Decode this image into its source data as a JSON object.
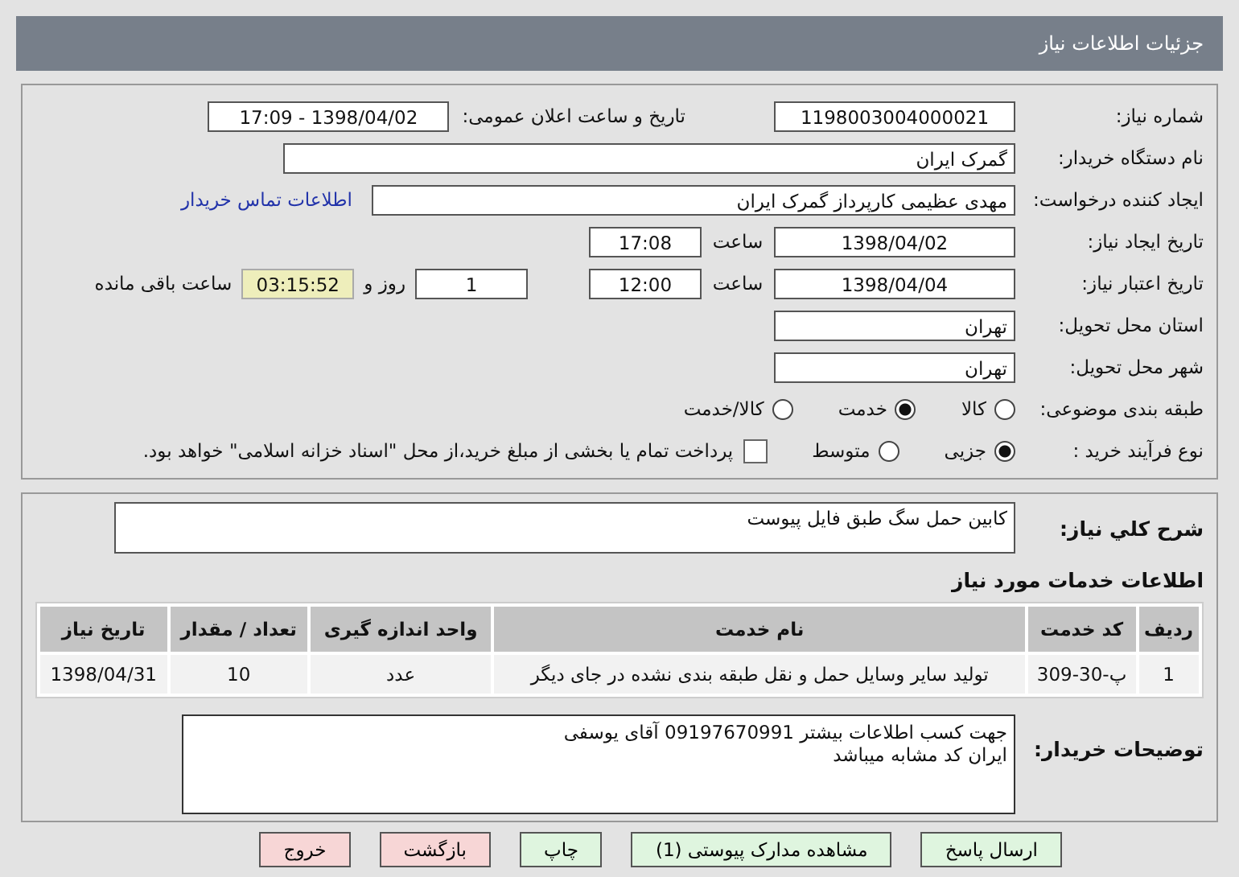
{
  "page_title": "جزئیات اطلاعات نیاز",
  "need_number": {
    "label": "شماره نیاز:",
    "value": "1198003004000021"
  },
  "announce": {
    "label": "تاریخ و ساعت اعلان عمومی:",
    "value": "1398/04/02 - 17:09"
  },
  "buyer": {
    "label": "نام دستگاه خریدار:",
    "value": "گمرک ایران"
  },
  "requester": {
    "label": "ایجاد کننده درخواست:",
    "value": "مهدی عظیمی کارپرداز گمرک ایران",
    "link": "اطلاعات تماس خریدار"
  },
  "created": {
    "label": "تاریخ ایجاد نیاز:",
    "date": "1398/04/02",
    "time_label": "ساعت",
    "time": "17:08"
  },
  "valid": {
    "label": "تاریخ اعتبار نیاز:",
    "date": "1398/04/04",
    "time_label": "ساعت",
    "time": "12:00",
    "days": "1",
    "days_label": "روز و",
    "remaining": "03:15:52",
    "remaining_label": "ساعت باقی مانده"
  },
  "province": {
    "label": "استان محل تحویل:",
    "value": "تهران"
  },
  "city": {
    "label": "شهر محل تحویل:",
    "value": "تهران"
  },
  "category": {
    "label": "طبقه بندی موضوعی:",
    "options": [
      {
        "label": "کالا",
        "selected": false
      },
      {
        "label": "خدمت",
        "selected": true
      },
      {
        "label": "کالا/خدمت",
        "selected": false
      }
    ]
  },
  "process": {
    "label": "نوع فرآیند خرید :",
    "options": [
      {
        "label": "جزیی",
        "selected": true
      },
      {
        "label": "متوسط",
        "selected": false
      }
    ],
    "payment": {
      "label": "پرداخت تمام یا بخشی از مبلغ خرید،از محل \"اسناد خزانه اسلامی\" خواهد بود.",
      "checked": false
    }
  },
  "summary": {
    "label": "شرح کلي نياز:",
    "value": "کابین حمل سگ طبق فایل پیوست"
  },
  "services": {
    "title": "اطلاعات خدمات مورد نیاز",
    "columns": [
      "ردیف",
      "کد خدمت",
      "نام خدمت",
      "واحد اندازه گیری",
      "تعداد / مقدار",
      "تاریخ نیاز"
    ],
    "rows": [
      [
        "1",
        "پ-30-309",
        "تولید سایر وسایل حمل و نقل طبقه بندی نشده در جای دیگر",
        "عدد",
        "10",
        "1398/04/31"
      ]
    ]
  },
  "notes": {
    "label": "توضیحات خریدار:",
    "lines": [
      "جهت کسب اطلاعات بیشتر 09197670991 آقای یوسفی",
      "ایران کد مشابه میباشد"
    ]
  },
  "buttons": [
    {
      "label": "ارسال پاسخ",
      "kind": "action"
    },
    {
      "label": "مشاهده مدارک پیوستی (1)",
      "kind": "action"
    },
    {
      "label": "چاپ",
      "kind": "action"
    },
    {
      "label": "بازگشت",
      "kind": "exit"
    },
    {
      "label": "خروج",
      "kind": "exit"
    }
  ]
}
